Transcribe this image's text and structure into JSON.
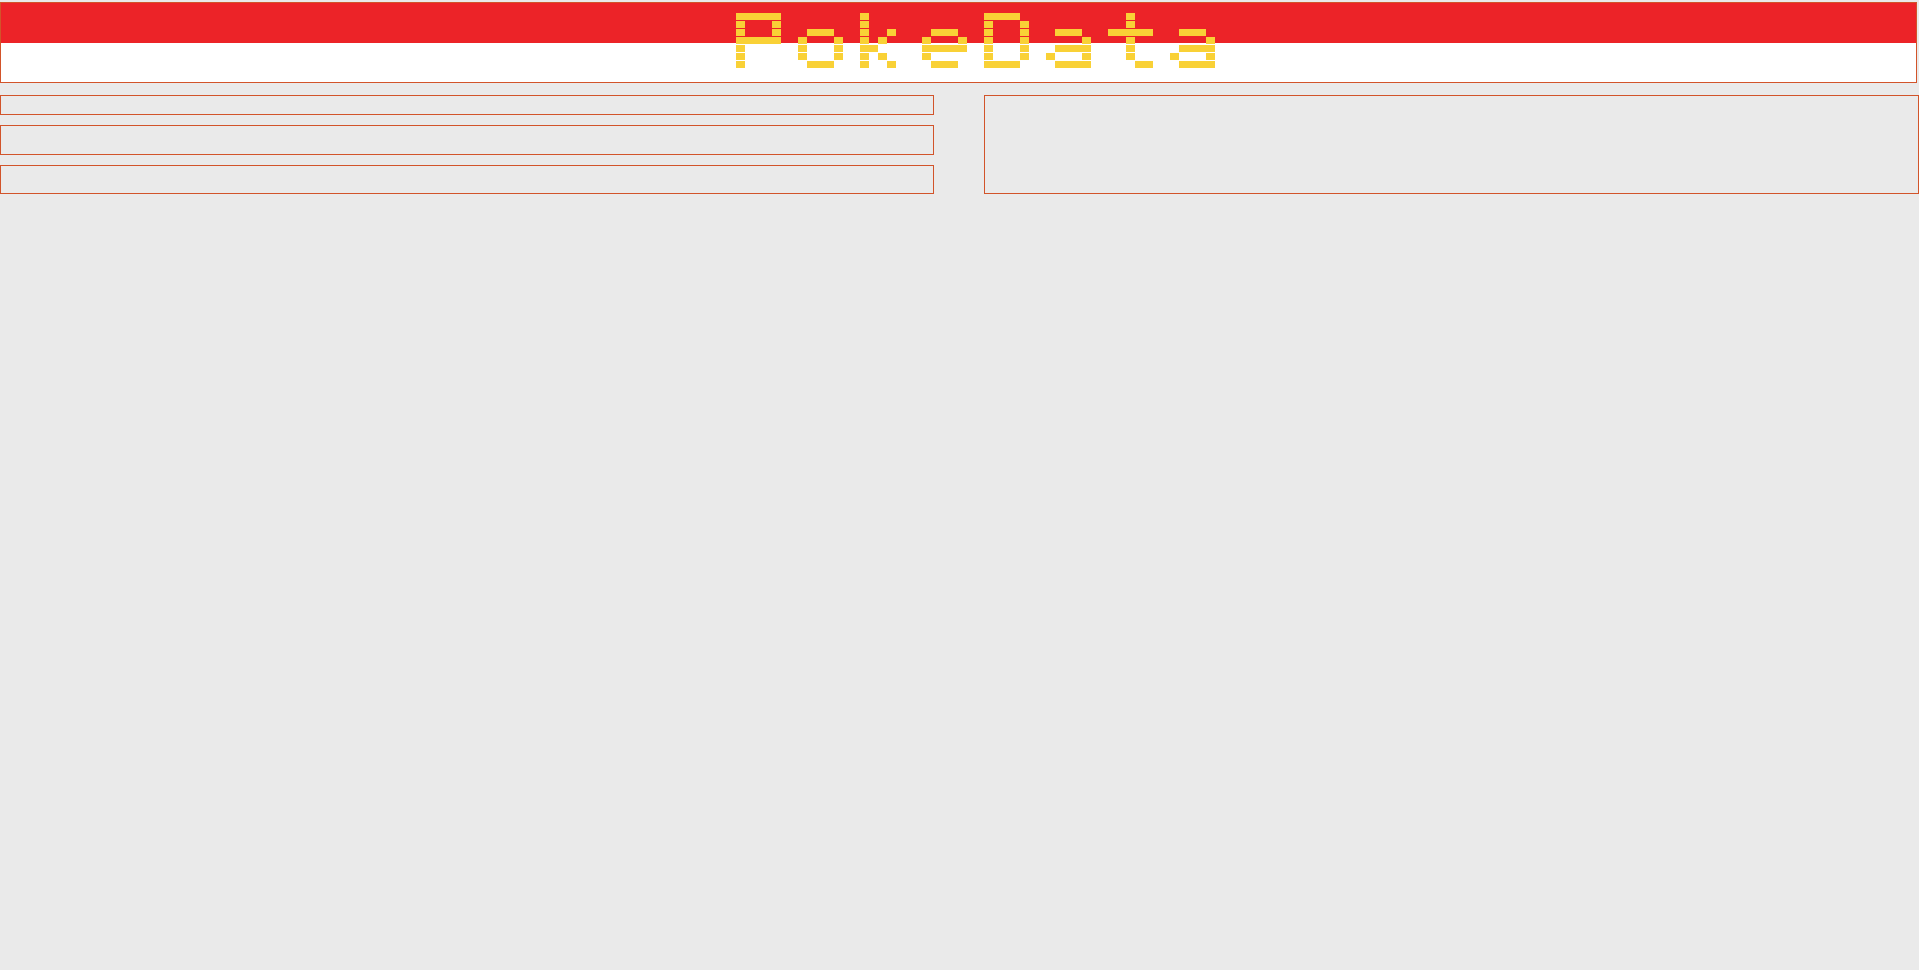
{
  "app": {
    "title": "PokeData"
  },
  "colors": {
    "banner_red": "#ec2328",
    "banner_white": "#ffffff",
    "logo_yellow": "#f9d136",
    "border_orange": "#d2542a",
    "background": "#eaeaea"
  },
  "icons": {
    "logo": "pokedata-pixel-logo"
  }
}
